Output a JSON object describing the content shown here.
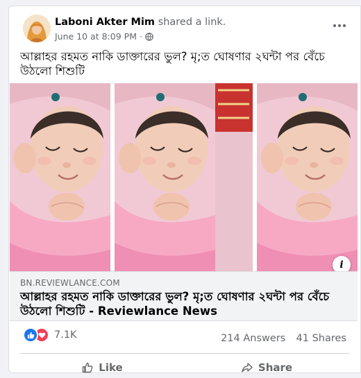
{
  "post": {
    "author_name": "Laboni Akter Mim",
    "author_action": "shared a link.",
    "timestamp": "June 10 at 8:09 PM",
    "meta_separator": "·",
    "privacy_icon": "globe-icon",
    "caption": "আল্লাহর রহমত নাকি ডাক্তারের ভুল? মৃ;ত ঘোষণার ২ঘন্টা পর বেঁচে উঠলো শিশুটি"
  },
  "link_preview": {
    "image_description_icon": "baby-photo",
    "domain": "BN.REVIEWLANCE.COM",
    "title": "আল্লাহর রহমত নাকি ডাক্তারের ভুল? মৃ;ত ঘোষণার ২ঘন্টা পর বেঁচে উঠলো শিশুটি",
    "title_separator": " - ",
    "source": "Reviewlance News",
    "info_label": "i"
  },
  "engagement": {
    "reaction_count": "7.1K",
    "answers": "214 Answers",
    "shares": "41 Shares"
  },
  "actions": {
    "like_label": "Like",
    "share_label": "Share"
  },
  "colors": {
    "like_blue": "#1877f2",
    "love_red": "#f33e58",
    "secondary_text": "#65676b",
    "link_meta_bg": "#f2f3f5"
  }
}
